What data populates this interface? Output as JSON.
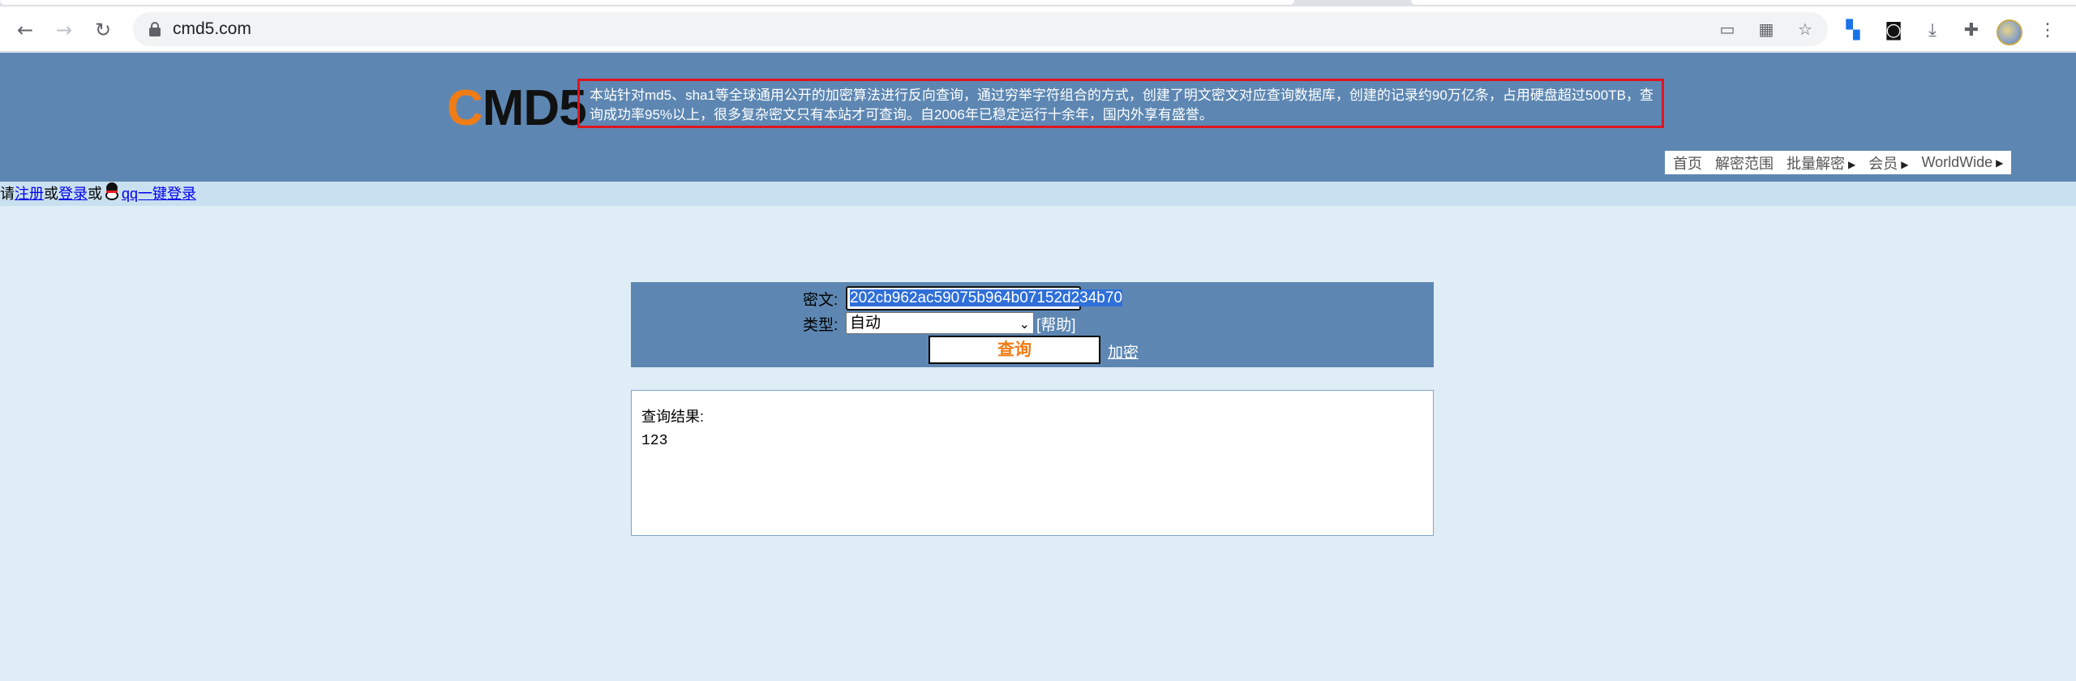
{
  "browser": {
    "url": "cmd5.com",
    "icons": {
      "back": "back-arrow-icon",
      "forward": "forward-arrow-icon",
      "reload": "reload-icon",
      "lock": "lock-icon",
      "cast": "cast-icon",
      "grid": "app-grid-icon",
      "star": "bookmark-star-icon",
      "menu": "kebab-menu-icon"
    }
  },
  "site": {
    "logo_c": "C",
    "logo_rest": "MD5",
    "notice": "本站针对md5、sha1等全球通用公开的加密算法进行反向查询，通过穷举字符组合的方式，创建了明文密文对应查询数据库，创建的记录约90万亿条，占用硬盘超过500TB，查询成功率95%以上，很多复杂密文只有本站才可查询。自2006年已稳定运行十余年，国内外享有盛誉。",
    "nav": [
      {
        "label": "首页",
        "arrow": false
      },
      {
        "label": "解密范围",
        "arrow": false
      },
      {
        "label": "批量解密",
        "arrow": true
      },
      {
        "label": "会员",
        "arrow": true
      },
      {
        "label": "WorldWide",
        "arrow": true
      }
    ],
    "arrow_glyph": "▶"
  },
  "login": {
    "please": "请",
    "register": "注册",
    "or1": "或",
    "login": "登录",
    "or2": "或",
    "qq_login": "qq一键登录"
  },
  "form": {
    "cipher_label": "密文:",
    "cipher_value": "202cb962ac59075b964b07152d234b70",
    "type_label": "类型:",
    "type_value": "自动",
    "help": "[帮助]",
    "submit": "查询",
    "encrypt": "加密"
  },
  "result": {
    "label": "查询结果:",
    "value": "123"
  },
  "colors": {
    "header_bg": "#5d87b2",
    "accent_orange": "#f07c17",
    "notice_border": "#e0141e",
    "page_bg": "#dfedf7"
  }
}
